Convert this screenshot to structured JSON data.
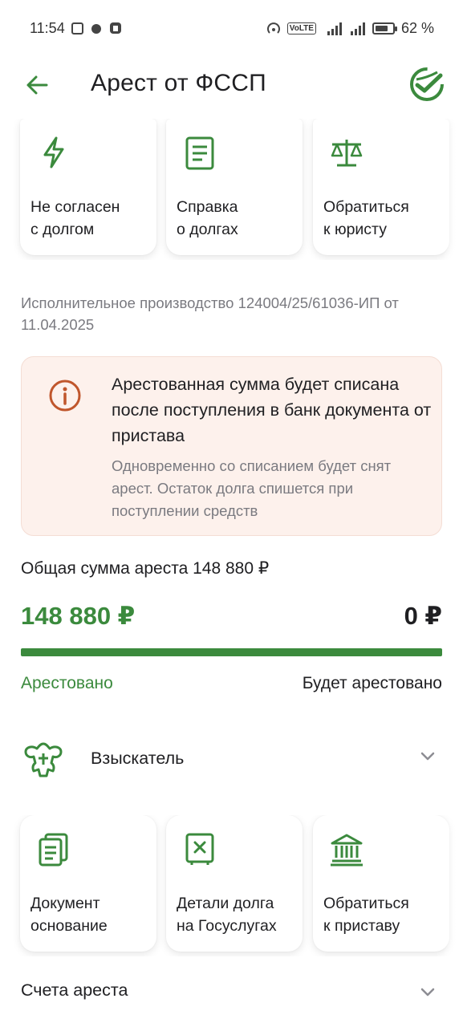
{
  "status_bar": {
    "time": "11:54",
    "battery_text": "62 %"
  },
  "header": {
    "title": "Арест от ФССП"
  },
  "top_cards": [
    {
      "label": "Не согласен\nс долгом",
      "icon": "lightning-icon"
    },
    {
      "label": "Справка\nо долгах",
      "icon": "document-icon"
    },
    {
      "label": "Обратиться\nк юристу",
      "icon": "scales-icon"
    }
  ],
  "proceeding": {
    "text": "Исполнительное производство 124004/25/61036-ИП от 11.04.2025"
  },
  "info": {
    "title": "Арестованная сумма будет списана после поступления в банк документа от пристава",
    "text": "Одновременно со списанием будет снят арест. Остаток долга спишется при поступлении средств",
    "icon": "info-icon"
  },
  "arrest": {
    "total_label": "Общая сумма ареста 148 880 ₽",
    "arrested_amount": "148 880 ₽",
    "pending_amount": "0 ₽",
    "arrested_label": "Арестовано",
    "pending_label": "Будет арестовано",
    "progress_fraction": 1.0
  },
  "collector": {
    "label": "Взыскатель",
    "icon": "emblem-icon"
  },
  "bottom_cards": [
    {
      "label": "Документ\nоснование",
      "icon": "documents-icon"
    },
    {
      "label": "Детали долга\nна Госуслугах",
      "icon": "gosuslugi-icon"
    },
    {
      "label": "Обратиться\nк приставу",
      "icon": "bank-building-icon"
    }
  ],
  "accounts": {
    "label": "Счета ареста"
  },
  "colors": {
    "accent": "#3b8a3d",
    "info_bg": "#fdf1ec",
    "info_icon": "#c0562c",
    "text_secondary": "#7a7a80"
  }
}
